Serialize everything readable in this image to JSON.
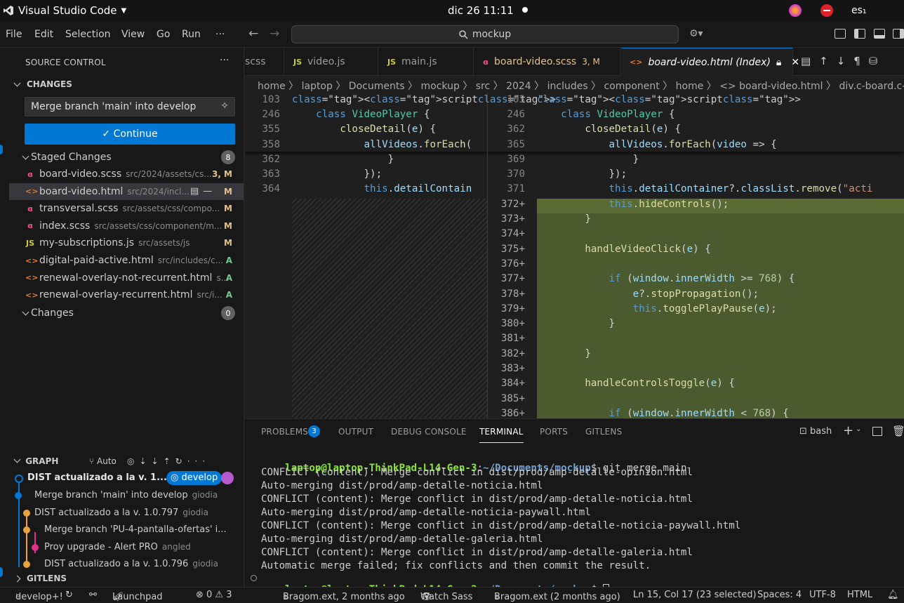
{
  "os": {
    "app": "Visual Studio Code",
    "clock": "dic 26  11:11",
    "lang": "es₁"
  },
  "menu": {
    "file": "File",
    "edit": "Edit",
    "selection": "Selection",
    "view": "View",
    "go": "Go",
    "run": "Run",
    "more": "···"
  },
  "search": {
    "text": "mockup"
  },
  "sidebar": {
    "title": "SOURCE CONTROL",
    "changes_header": "CHANGES",
    "commit_message": "Merge branch 'main' into develop",
    "continue_label": "✓ Continue",
    "staged_label": "Staged Changes",
    "staged_count": "8",
    "files": [
      {
        "icon": "scss",
        "name": "board-video.scss",
        "path": "src/2024/assets/cs...",
        "status": "3, M",
        "status_color": "#e2c08d"
      },
      {
        "icon": "html",
        "name": "board-video.html",
        "path": "src/2024/incl...",
        "status": "M",
        "status_color": "#e2c08d"
      },
      {
        "icon": "scss",
        "name": "transversal.scss",
        "path": "src/assets/css/compo...",
        "status": "M",
        "status_color": "#e2c08d"
      },
      {
        "icon": "scss",
        "name": "index.scss",
        "path": "src/assets/css/component/m...",
        "status": "M",
        "status_color": "#e2c08d"
      },
      {
        "icon": "js",
        "name": "my-subscriptions.js",
        "path": "src/assets/js",
        "status": "M",
        "status_color": "#e2c08d"
      },
      {
        "icon": "html",
        "name": "digital-paid-active.html",
        "path": "src/includes/c...",
        "status": "A",
        "status_color": "#73c991"
      },
      {
        "icon": "html",
        "name": "renewal-overlay-not-recurrent.html",
        "path": "s...",
        "status": "A",
        "status_color": "#73c991"
      },
      {
        "icon": "html",
        "name": "renewal-overlay-recurrent.html",
        "path": "src/i...",
        "status": "A",
        "status_color": "#73c991"
      }
    ],
    "unstaged_label": "Changes",
    "unstaged_count": "0",
    "graph": {
      "title": "GRAPH",
      "auto": "Auto",
      "head": "DIST actualizado a la v. 1...",
      "branch": "develop",
      "commits": [
        {
          "msg": "Merge branch 'main' into develop",
          "author": "giodia"
        },
        {
          "msg": "DIST actualizado a la v. 1.0.797",
          "author": "giodia"
        },
        {
          "msg": "Merge branch 'PU-4-pantalla-ofertas' i...",
          "author": ""
        },
        {
          "msg": "Proy upgrade - Alert PRO",
          "author": "angled"
        },
        {
          "msg": "DIST actualizado a la v. 1.0.796",
          "author": "giodia"
        }
      ]
    },
    "gitlens": "GITLENS"
  },
  "tabs": [
    {
      "label": "scss",
      "icon": ""
    },
    {
      "label": "video.js",
      "icon": "JS"
    },
    {
      "label": "main.js",
      "icon": "JS"
    },
    {
      "label": "board-video.scss",
      "icon": "scss",
      "extra": "3, M"
    },
    {
      "label": "board-video.html (Index)",
      "icon": "html"
    }
  ],
  "breadcrumb": "home  〉 laptop  〉 Documents  〉 mockup  〉 src  〉 2024  〉 includes  〉 component  〉 home  〉 <> board-video.html  〉 div.c-board.c-board-video",
  "editor": {
    "left_lines": [
      {
        "n": "103",
        "code": "<script>"
      },
      {
        "n": "246",
        "code": "    class VideoPlayer {"
      },
      {
        "n": "355",
        "code": "        closeDetail(e) {"
      },
      {
        "n": "358",
        "code": "            allVideos.forEach("
      },
      {
        "n": "362",
        "code": "                }"
      },
      {
        "n": "363",
        "code": "            });"
      },
      {
        "n": "364",
        "code": "            this.detailContain"
      }
    ],
    "right_lines": [
      {
        "n": "103",
        "code": "<script>"
      },
      {
        "n": "246",
        "code": "    class VideoPlayer {"
      },
      {
        "n": "362",
        "code": "        closeDetail(e) {"
      },
      {
        "n": "365",
        "code": "            allVideos.forEach(video => {"
      },
      {
        "n": "369",
        "code": "                }"
      },
      {
        "n": "370",
        "code": "            });"
      },
      {
        "n": "371",
        "code": "            this.detailContainer?.classList.remove(\"acti"
      },
      {
        "n": "372+",
        "code": "            this.hideControls();"
      },
      {
        "n": "373+",
        "code": "        }"
      },
      {
        "n": "374+",
        "code": ""
      },
      {
        "n": "375+",
        "code": "        handleVideoClick(e) {"
      },
      {
        "n": "376+",
        "code": ""
      },
      {
        "n": "377+",
        "code": "            if (window.innerWidth >= 768) {"
      },
      {
        "n": "378+",
        "code": "                e?.stopPropagation();"
      },
      {
        "n": "379+",
        "code": "                this.togglePlayPause(e);"
      },
      {
        "n": "380+",
        "code": "            }"
      },
      {
        "n": "381+",
        "code": ""
      },
      {
        "n": "382+",
        "code": "        }"
      },
      {
        "n": "383+",
        "code": ""
      },
      {
        "n": "384+",
        "code": "        handleControlsToggle(e) {"
      },
      {
        "n": "385+",
        "code": ""
      },
      {
        "n": "386+",
        "code": "            if (window.innerWidth < 768) {"
      }
    ]
  },
  "panel": {
    "tabs": [
      "PROBLEMS",
      "OUTPUT",
      "DEBUG CONSOLE",
      "TERMINAL",
      "PORTS",
      "GITLENS"
    ],
    "problems_count": "3",
    "shell": "bash",
    "prompt_user": "laptop@laptop-ThinkPad-L14-Gen-3",
    "prompt_path": "~/Documents/mockup",
    "command": "git merge main",
    "output": [
      "CONFLICT (content): Merge conflict in dist/prod/amp-detalle-opinion.html",
      "Auto-merging dist/prod/amp-detalle-noticia.html",
      "CONFLICT (content): Merge conflict in dist/prod/amp-detalle-noticia.html",
      "Auto-merging dist/prod/amp-detalle-noticia-paywall.html",
      "CONFLICT (content): Merge conflict in dist/prod/amp-detalle-noticia-paywall.html",
      "Auto-merging dist/prod/amp-detalle-galeria.html",
      "CONFLICT (content): Merge conflict in dist/prod/amp-detalle-galeria.html",
      "Automatic merge failed; fix conflicts and then commit the result."
    ]
  },
  "status": {
    "branch": "develop+!",
    "launchpad": "Launchpad",
    "problems": "⊗ 0 ⚠ 3",
    "blame1": "Bragom.ext, 2 months ago",
    "watch": "Watch Sass",
    "blame2": "Bragom.ext (2 months ago)",
    "position": "Ln 15, Col 17 (23 selected)",
    "spaces": "Spaces: 4",
    "encoding": "UTF-8",
    "language": "HTML"
  },
  "colors": {
    "accent": "#0078d4",
    "added_bg": "#4b5a2f",
    "modified": "#e2c08d",
    "added": "#73c991"
  }
}
